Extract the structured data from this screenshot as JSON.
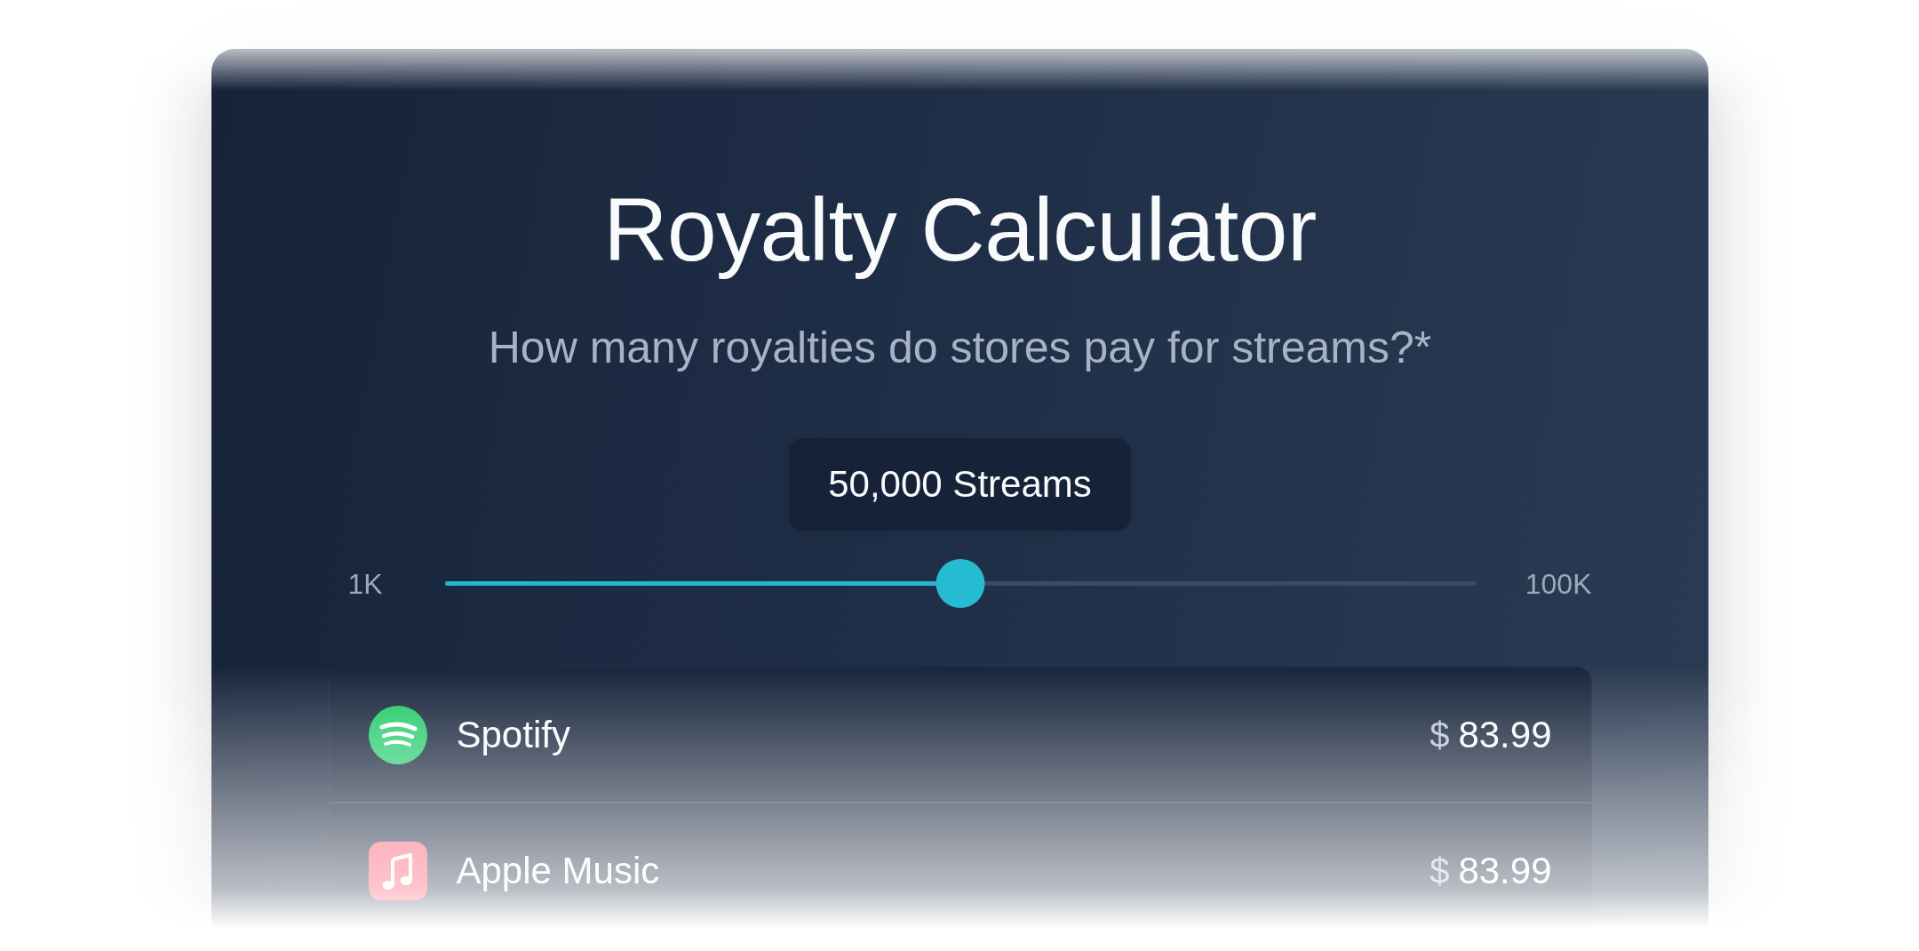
{
  "card": {
    "title": "Royalty Calculator",
    "subtitle": "How many royalties do stores pay for streams?*"
  },
  "streams": {
    "value_label": "50,000 Streams",
    "min_label": "1K",
    "max_label": "100K",
    "level": 0.5
  },
  "stores": [
    {
      "kind": "waves",
      "name": "Spotify",
      "currency": "$",
      "amount": "83.99"
    },
    {
      "kind": "note",
      "name": "Apple Music",
      "currency": "$",
      "amount": "83.99"
    }
  ]
}
